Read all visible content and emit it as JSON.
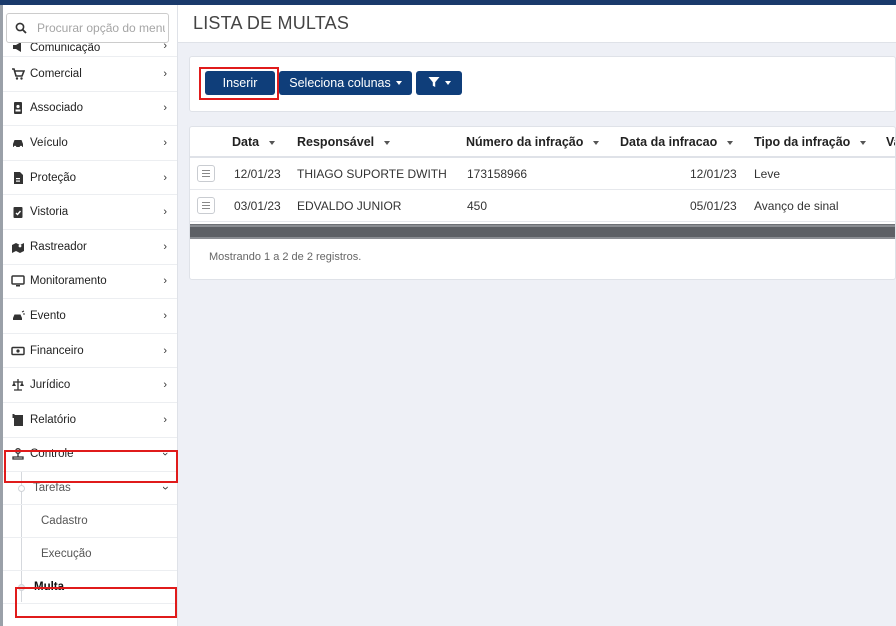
{
  "search": {
    "placeholder": "Procurar opção do menu"
  },
  "sidebar": {
    "items": [
      {
        "label": "Comunicação",
        "icon": "megaphone-icon"
      },
      {
        "label": "Comercial",
        "icon": "cart-icon"
      },
      {
        "label": "Associado",
        "icon": "id-card-icon"
      },
      {
        "label": "Veículo",
        "icon": "car-icon"
      },
      {
        "label": "Proteção",
        "icon": "document-icon"
      },
      {
        "label": "Vistoria",
        "icon": "clipboard-check-icon"
      },
      {
        "label": "Rastreador",
        "icon": "map-marker-icon"
      },
      {
        "label": "Monitoramento",
        "icon": "monitor-icon"
      },
      {
        "label": "Evento",
        "icon": "car-crash-icon"
      },
      {
        "label": "Financeiro",
        "icon": "money-icon"
      },
      {
        "label": "Jurídico",
        "icon": "scale-icon"
      },
      {
        "label": "Relatório",
        "icon": "report-icon"
      },
      {
        "label": "Controle",
        "icon": "stamp-icon"
      }
    ],
    "controle_sub": {
      "tarefas": "Tarefas",
      "cadastro": "Cadastro",
      "execucao": "Execução",
      "multa": "Multa"
    }
  },
  "header": {
    "title": "LISTA DE MULTAS"
  },
  "toolbar": {
    "insert_label": "Inserir",
    "columns_label": "Seleciona colunas"
  },
  "table": {
    "columns": [
      "Data",
      "Responsável",
      "Número da infração",
      "Data da infracao",
      "Tipo da infração",
      "Va"
    ],
    "rows": [
      [
        "12/01/23",
        "THIAGO SUPORTE DWITH",
        "173158966",
        "12/01/23",
        "Leve"
      ],
      [
        "03/01/23",
        "EDVALDO JUNIOR",
        "450",
        "05/01/23",
        "Avanço de sinal"
      ]
    ],
    "footer": "Mostrando 1 a 2 de 2 registros."
  },
  "colors": {
    "primary": "#0f3e7a",
    "highlight": "#e01b1b",
    "topbar": "#1a3a6b"
  }
}
